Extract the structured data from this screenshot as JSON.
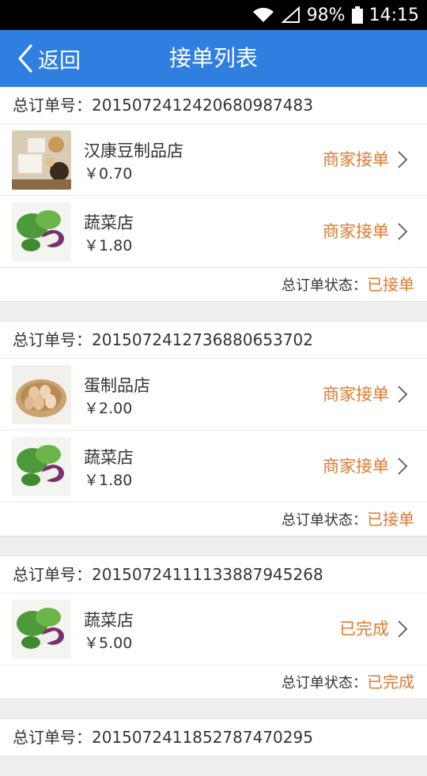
{
  "statusbar": {
    "battery": "98%",
    "time": "14:15"
  },
  "header": {
    "back_label": "返回",
    "title": "接单列表"
  },
  "orders": [
    {
      "order_label": "总订单号：",
      "order_no": "20150724124206809 87483",
      "stores": [
        {
          "name": "汉康豆制品店",
          "price": "￥0.70",
          "status": "商家接单",
          "image": "tofu-image"
        },
        {
          "name": "蔬菜店",
          "price": "￥1.80",
          "status": "商家接单",
          "image": "vegetable-image"
        }
      ],
      "status_label": "总订单状态：",
      "status_value": "已接单"
    },
    {
      "order_label": "总订单号：",
      "order_no": "201507241273688065 3702",
      "stores": [
        {
          "name": "蛋制品店",
          "price": "￥2.00",
          "status": "商家接单",
          "image": "egg-image"
        },
        {
          "name": "蔬菜店",
          "price": "￥1.80",
          "status": "商家接单",
          "image": "vegetable-image"
        }
      ],
      "status_label": "总订单状态：",
      "status_value": "已接单"
    },
    {
      "order_label": "总订单号：",
      "order_no": "201507241111338879 45268",
      "stores": [
        {
          "name": "蔬菜店",
          "price": "￥5.00",
          "status": "已完成",
          "image": "vegetable-image"
        }
      ],
      "status_label": "总订单状态：",
      "status_value": "已完成"
    },
    {
      "order_label": "总订单号：",
      "order_no": "201507241185278747 0295",
      "stores": [],
      "status_label": "",
      "status_value": ""
    }
  ]
}
